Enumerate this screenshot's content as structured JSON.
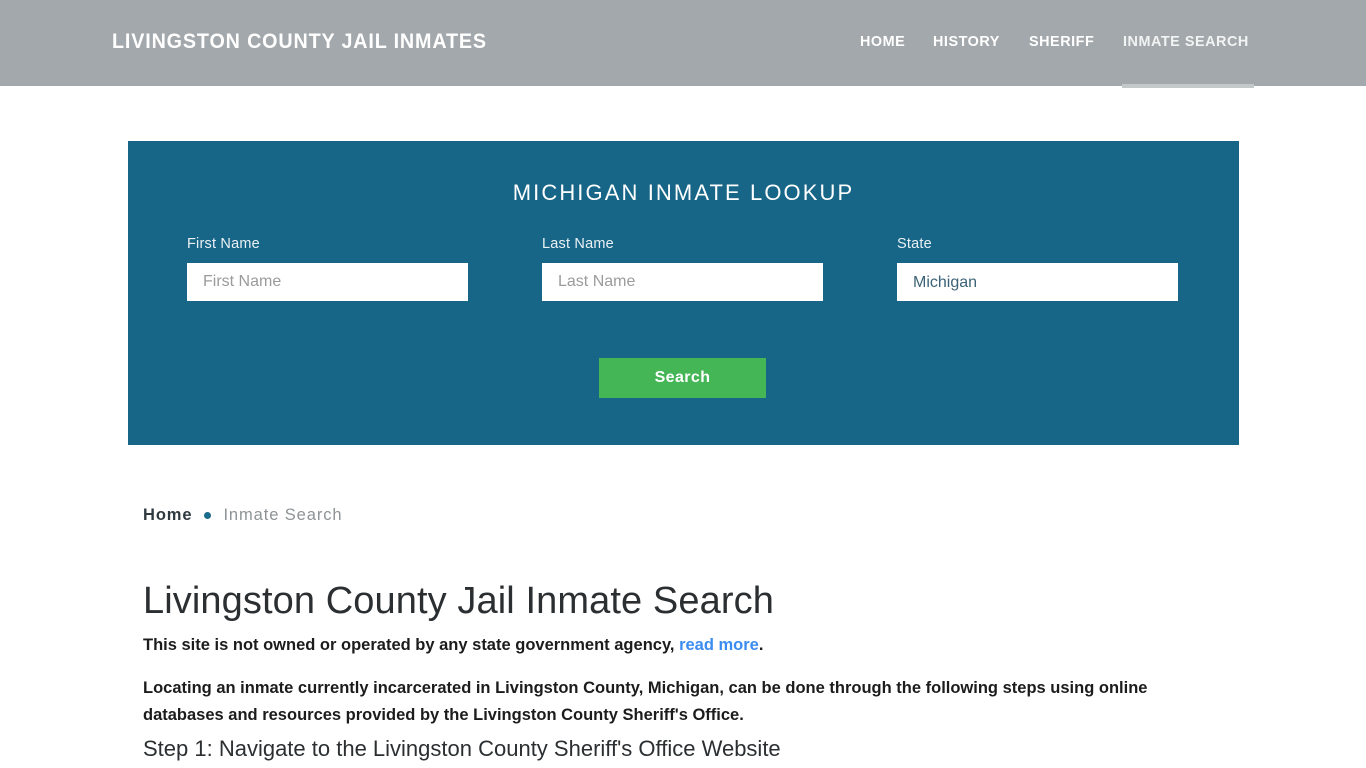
{
  "header": {
    "brand": "LIVINGSTON COUNTY JAIL INMATES",
    "nav": [
      {
        "label": "HOME",
        "active": false
      },
      {
        "label": "HISTORY",
        "active": false
      },
      {
        "label": "SHERIFF",
        "active": false
      },
      {
        "label": "INMATE SEARCH",
        "active": true
      }
    ],
    "background_color": "#a2a8ab",
    "active_bar_color": "#c3c8ca"
  },
  "lookup": {
    "title": "MICHIGAN INMATE LOOKUP",
    "panel_color": "#176587",
    "fields": {
      "first_name": {
        "label": "First Name",
        "value": "",
        "placeholder": "First Name"
      },
      "last_name": {
        "label": "Last Name",
        "value": "",
        "placeholder": "Last Name"
      },
      "state": {
        "label": "State",
        "value": "Michigan",
        "options": [
          "Michigan"
        ]
      }
    },
    "search_label": "Search",
    "search_color": "#45b656"
  },
  "breadcrumb": {
    "home": "Home",
    "separator": "•",
    "current": "Inmate Search"
  },
  "main": {
    "title": "Livingston County Jail Inmate Search",
    "disclaimer_text": "This site is not owned or operated by any state government agency,",
    "disclaimer_link": "read more",
    "disclaimer_end": ".",
    "disclaimer_link_color": "#3b8cf0",
    "intro": "Locating an inmate currently incarcerated in Livingston County, Michigan, can be done through the following steps using online databases and resources provided by the Livingston County Sheriff's Office.",
    "step_heading": "Step 1: Navigate to the Livingston County Sheriff's Office Website"
  }
}
